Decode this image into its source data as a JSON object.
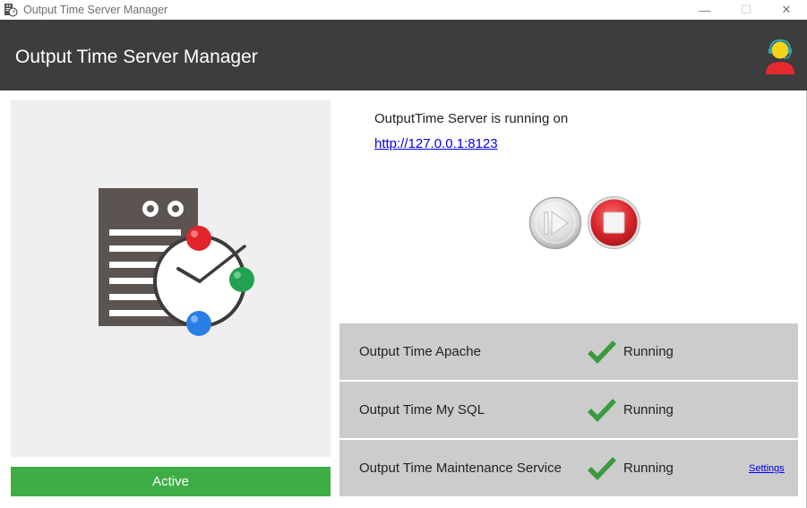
{
  "window": {
    "title": "Output Time Server Manager",
    "controls": {
      "minimize": "—",
      "maximize": "☐",
      "close": "✕"
    }
  },
  "header": {
    "title": "Output Time Server Manager",
    "icon": "support-agent-icon"
  },
  "left_panel": {
    "illustration": "server-clock-icon",
    "status": "Active"
  },
  "server": {
    "running_label": "OutputTime Server is running on",
    "url": "http://127.0.0.1:8123",
    "play_icon": "play-icon",
    "stop_icon": "stop-icon"
  },
  "services": [
    {
      "name": "Output Time Apache",
      "status": "Running"
    },
    {
      "name": "Output Time My SQL",
      "status": "Running"
    },
    {
      "name": "Output Time Maintenance Service",
      "status": "Running",
      "link": "Settings"
    }
  ],
  "colors": {
    "header_bg": "#3d3d3d",
    "active_green": "#3fad46",
    "check_green": "#3a9a3e",
    "stop_red": "#d6262a",
    "service_bg": "#cccccc",
    "panel_bg": "#efefef"
  }
}
